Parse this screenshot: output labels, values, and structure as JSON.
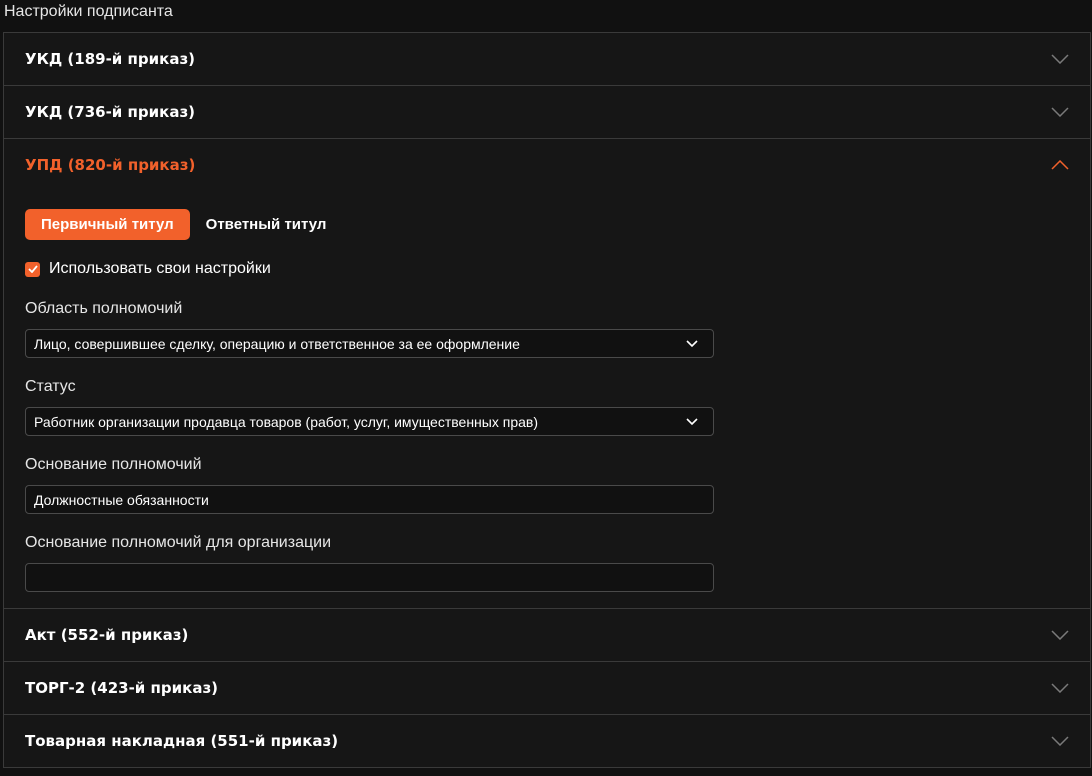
{
  "page": {
    "title": "Настройки подписанта"
  },
  "colors": {
    "accent": "#f2612b",
    "background": "#111111",
    "border": "#3a3a3a"
  },
  "sections": [
    {
      "label": "УКД (189-й приказ)",
      "expanded": false
    },
    {
      "label": "УКД (736-й приказ)",
      "expanded": false
    },
    {
      "label": "УПД (820-й приказ)",
      "expanded": true
    },
    {
      "label": "Акт (552-й приказ)",
      "expanded": false
    },
    {
      "label": "ТОРГ-2 (423-й приказ)",
      "expanded": false
    },
    {
      "label": "Товарная накладная (551-й приказ)",
      "expanded": false
    }
  ],
  "upd": {
    "tabs": [
      {
        "label": "Первичный титул",
        "active": true
      },
      {
        "label": "Ответный титул",
        "active": false
      }
    ],
    "use_own_settings": {
      "label": "Использовать свои настройки",
      "checked": true
    },
    "authority_area": {
      "label": "Область полномочий",
      "value": "Лицо, совершившее сделку, операцию и ответственное за ее оформление"
    },
    "status": {
      "label": "Статус",
      "value": "Работник организации продавца товаров (работ, услуг, имущественных прав)"
    },
    "authority_basis": {
      "label": "Основание полномочий",
      "value": "Должностные обязанности"
    },
    "authority_basis_org": {
      "label": "Основание полномочий для организации",
      "value": ""
    }
  }
}
